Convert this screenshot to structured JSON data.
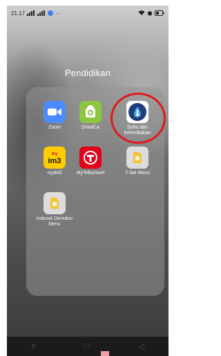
{
  "status_bar": {
    "time": "21.17",
    "indicators_left": "⁴ᴳ ...ıl ...ıl",
    "overflow": "···"
  },
  "folder": {
    "title": "Pendidikan",
    "apps": [
      {
        "label": "Zoom",
        "icon": "zoom-icon",
        "color": "#4a8cff"
      },
      {
        "label": "DroidCa",
        "icon": "droidcam-icon",
        "color": "#8dc63f"
      },
      {
        "label": "Suhu dan Kelembaban",
        "icon": "suhu-kelembaban-icon",
        "color": "#1f3f79"
      },
      {
        "label": "myIM3",
        "icon": "myim3-icon",
        "color": "#ffcc00"
      },
      {
        "label": "MyTelkomsel",
        "icon": "mytelkomsel-icon",
        "color": "#e2001a"
      },
      {
        "label": "T-Sel Menu",
        "icon": "sim-card-icon",
        "color": "#f3c43a"
      },
      {
        "label": "Indosat Ooredoo Menu",
        "icon": "sim-card-icon",
        "color": "#f3c43a"
      }
    ]
  },
  "highlight": {
    "color": "#e3161b"
  },
  "nav_bar": {
    "menu": "≡",
    "home": "□",
    "back": "◁"
  }
}
